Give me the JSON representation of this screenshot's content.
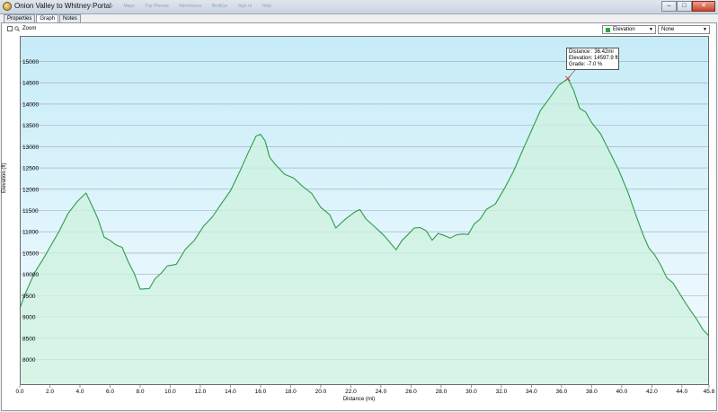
{
  "window": {
    "title": "Onion Valley to Whitney Portal",
    "menu_items": [
      "File",
      "Tools",
      "Maps",
      "Trip Planner",
      "Adventures",
      "BirdEye",
      "Sign In",
      "Help"
    ],
    "controls": {
      "minimize": "–",
      "maximize": "□",
      "close": "✕"
    }
  },
  "tabs": [
    {
      "label": "Properties"
    },
    {
      "label": "Graph"
    },
    {
      "label": "Notes"
    }
  ],
  "toolbar": {
    "zoom_label": "Zoom",
    "zoom_checked": false,
    "primary_select": "Elevation",
    "secondary_select": "None",
    "series_color": "#2ea44f"
  },
  "tooltip": {
    "distance": "Distance : 36.42mi",
    "elevation": "Elevation: 14597.9 ft",
    "grade": "Grade: -7.0 %"
  },
  "chart_data": {
    "type": "area",
    "xlabel": "Distance  (mi)",
    "ylabel": "Elevation (ft)",
    "xlim": [
      0,
      45.8
    ],
    "ylim": [
      7400,
      15600
    ],
    "x_ticks": [
      "0.0",
      "2.0",
      "4.0",
      "6.0",
      "8.0",
      "10.0",
      "12.0",
      "14.0",
      "16.0",
      "18.0",
      "20.0",
      "22.0",
      "24.0",
      "26.0",
      "28.0",
      "30.0",
      "32.0",
      "34.0",
      "36.0",
      "38.0",
      "40.0",
      "42.0",
      "44.0",
      "45.8"
    ],
    "y_ticks": [
      "8000",
      "8500",
      "9000",
      "9500",
      "10000",
      "10500",
      "11000",
      "11500",
      "12000",
      "12500",
      "13000",
      "13500",
      "14000",
      "14500",
      "15000"
    ],
    "grid": true,
    "highlight_x": 36.42,
    "line_color": "#2e9c4a",
    "fill_color": "#cdf2df",
    "background_top": "#c6ecf8",
    "background_bottom": "#f6fcff",
    "series": [
      {
        "x": [
          0,
          0.4,
          1.0,
          1.6,
          2.0,
          2.6,
          3.2,
          3.8,
          4.4,
          4.8,
          5.2,
          5.6,
          6.0,
          6.4,
          6.8,
          7.2,
          7.6,
          8.0,
          8.3,
          8.6,
          9.0,
          9.4,
          9.8,
          10.4,
          11.0,
          11.6,
          12.2,
          12.8,
          13.4,
          14.0,
          14.6,
          15.2,
          15.7,
          16.0,
          16.3,
          16.6,
          17.0,
          17.6,
          18.2,
          18.8,
          19.4,
          20.0,
          20.6,
          21.0,
          21.6,
          22.2,
          22.6,
          23.0,
          23.6,
          24.2,
          24.6,
          25.0,
          25.4,
          25.8,
          26.2,
          26.6,
          27.0,
          27.4,
          27.8,
          28.2,
          28.6,
          29.0,
          29.4,
          29.8,
          30.2,
          30.6,
          31.0,
          31.6,
          32.2,
          32.8,
          33.4,
          34.0,
          34.6,
          35.2,
          35.8,
          36.42,
          36.8,
          37.2,
          37.6,
          38.0,
          38.6,
          39.2,
          39.8,
          40.4,
          41.0,
          41.4,
          41.8,
          42.2,
          42.6,
          43.0,
          43.4,
          43.8,
          44.2,
          44.6,
          45.0,
          45.4,
          45.8
        ],
        "y": [
          9200,
          9600,
          10000,
          10400,
          10600,
          11000,
          11400,
          11750,
          11900,
          11650,
          11300,
          10900,
          10750,
          10700,
          10600,
          10300,
          10000,
          9700,
          9650,
          9700,
          9900,
          10050,
          10150,
          10250,
          10550,
          10800,
          11100,
          11400,
          11650,
          12000,
          12400,
          12900,
          13200,
          13300,
          13100,
          12750,
          12550,
          12400,
          12250,
          12100,
          11900,
          11600,
          11350,
          11100,
          11250,
          11450,
          11500,
          11350,
          11100,
          10950,
          10750,
          10600,
          10750,
          10950,
          11050,
          11100,
          11000,
          10850,
          10950,
          10950,
          10850,
          10950,
          10900,
          10950,
          11150,
          11300,
          11500,
          11700,
          12000,
          12450,
          12900,
          13400,
          13800,
          14150,
          14400,
          14597,
          14300,
          13950,
          13800,
          13600,
          13300,
          12900,
          12400,
          11950,
          11300,
          10950,
          10600,
          10500,
          10200,
          9950,
          9800,
          9600,
          9300,
          9150,
          8900,
          8700,
          8550
        ]
      }
    ]
  }
}
